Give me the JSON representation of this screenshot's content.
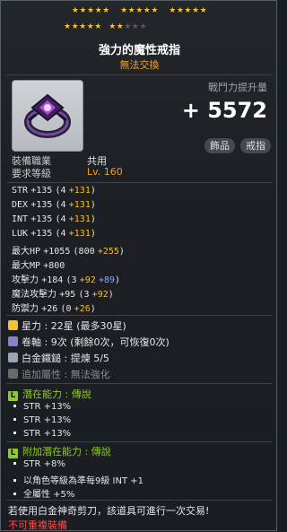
{
  "stars": {
    "row1": [
      "★★★★★",
      "★★★★★",
      "★★★★★"
    ],
    "row2_filled": [
      "★★★★★",
      "★★"
    ],
    "row2_empty": "★★★"
  },
  "header": {
    "title": "強力的魔性戒指",
    "subtitle": "無法交換"
  },
  "combat": {
    "label": "戰鬥力提升量",
    "value": "+ 5572"
  },
  "tags": [
    "飾品",
    "戒指"
  ],
  "requirements": {
    "job_label": "裝備職業",
    "job_value": "共用",
    "level_label": "要求等級",
    "level_value": "Lv. 160"
  },
  "stats": [
    {
      "name": "STR",
      "base": "+135",
      "paren": "(4",
      "bonus": "+131",
      "close": ")"
    },
    {
      "name": "DEX",
      "base": "+135",
      "paren": "(4",
      "bonus": "+131",
      "close": ")"
    },
    {
      "name": "INT",
      "base": "+135",
      "paren": "(4",
      "bonus": "+131",
      "close": ")"
    },
    {
      "name": "LUK",
      "base": "+135",
      "paren": "(4",
      "bonus": "+131",
      "close": ")"
    },
    {
      "name": "最大HP",
      "base": "+1055",
      "paren": "(800",
      "bonus": "+255",
      "close": ")"
    },
    {
      "name": "最大MP",
      "base": "+800",
      "paren": "",
      "bonus": "",
      "close": ""
    },
    {
      "name": "攻擊力",
      "base": "+184",
      "paren": "(3",
      "bonus": "+92",
      "extra": "+89",
      "close": ")"
    },
    {
      "name": "魔法攻擊力",
      "base": "+95",
      "paren": "(3",
      "bonus": "+92",
      "close": ")"
    },
    {
      "name": "防禦力",
      "base": "+26",
      "paren": "(0",
      "bonus": "+26",
      "close": ")"
    }
  ],
  "info": {
    "star": "星力 : 22星 (最多30星)",
    "scroll": "卷軸 : 9次 (剩餘0次，可恢復0次)",
    "hammer": "白金鐵鎚 : 提煉 5/5",
    "extra": "追加屬性 : 無法強化"
  },
  "potential": {
    "title": "潛在能力 : 傳說",
    "lines": [
      "STR +13%",
      "STR +13%",
      "STR +13%"
    ]
  },
  "additional": {
    "title": "附加潛在能力 : 傳說",
    "lines": [
      "STR +8%",
      "以角色等級為準每9級 INT +1",
      "全屬性 +5%"
    ]
  },
  "footer": {
    "line1": "若使用白金神奇剪刀，該道具可進行一次交易!",
    "line2": "不可重複裝備"
  },
  "colors": {
    "gold": "#f4c01f",
    "blue": "#8ea8ff",
    "orange": "#f2a020",
    "green": "#8ecb2a",
    "red": "#ff4a4a"
  }
}
